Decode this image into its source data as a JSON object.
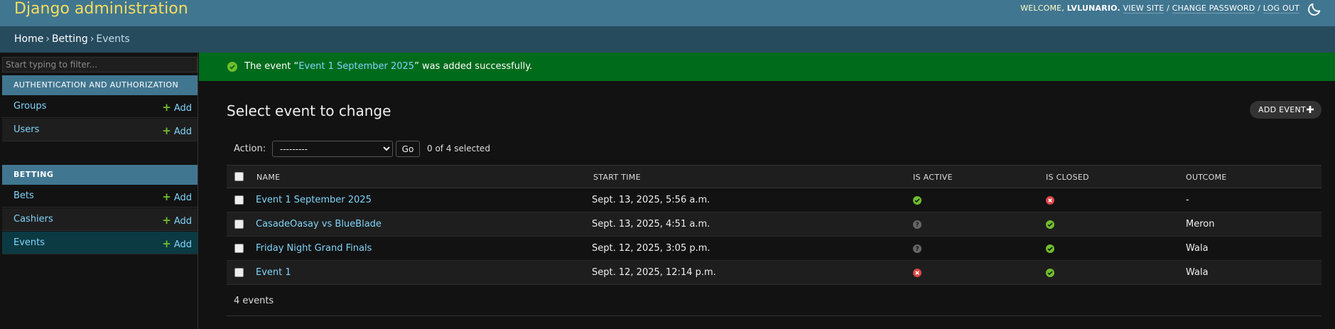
{
  "header": {
    "site_name": "Django administration",
    "welcome": "WELCOME,",
    "username": "LVLUNARIO.",
    "view_site": "VIEW SITE",
    "change_password": "CHANGE PASSWORD",
    "log_out": "LOG OUT",
    "separator": "/"
  },
  "breadcrumbs": {
    "home": "Home",
    "app": "Betting",
    "current": "Events",
    "separator": "›"
  },
  "sidebar": {
    "filter_placeholder": "Start typing to filter...",
    "modules": [
      {
        "caption": "AUTHENTICATION AND AUTHORIZATION",
        "models": [
          {
            "name": "Groups",
            "add": "Add"
          },
          {
            "name": "Users",
            "add": "Add"
          }
        ]
      },
      {
        "caption": "BETTING",
        "models": [
          {
            "name": "Bets",
            "add": "Add"
          },
          {
            "name": "Cashiers",
            "add": "Add"
          },
          {
            "name": "Events",
            "add": "Add"
          }
        ]
      }
    ]
  },
  "message": {
    "prefix": "The event “",
    "link": "Event 1 September 2025",
    "suffix": "” was added successfully."
  },
  "content": {
    "title": "Select event to change",
    "add_button": "ADD EVENT"
  },
  "actions": {
    "label": "Action:",
    "selected_option": "---------",
    "go": "Go",
    "selected_count": "0 of 4 selected"
  },
  "table": {
    "headers": [
      "NAME",
      "START TIME",
      "IS ACTIVE",
      "IS CLOSED",
      "OUTCOME"
    ],
    "rows": [
      {
        "name": "Event 1 September 2025",
        "start_time": "Sept. 13, 2025, 5:56 a.m.",
        "is_active": "yes",
        "is_closed": "no",
        "outcome": "-"
      },
      {
        "name": "CasadeOasay vs BlueBlade",
        "start_time": "Sept. 13, 2025, 4:51 a.m.",
        "is_active": "unknown",
        "is_closed": "yes",
        "outcome": "Meron"
      },
      {
        "name": "Friday Night Grand Finals",
        "start_time": "Sept. 12, 2025, 3:05 p.m.",
        "is_active": "unknown",
        "is_closed": "yes",
        "outcome": "Wala"
      },
      {
        "name": "Event 1",
        "start_time": "Sept. 12, 2025, 12:14 p.m.",
        "is_active": "no",
        "is_closed": "yes",
        "outcome": "Wala"
      }
    ]
  },
  "paginator": {
    "count": "4 events"
  },
  "colors": {
    "header_bg": "#417690",
    "breadcrumb_bg": "#264b5d",
    "branding": "#f5dd5d",
    "success_bg": "#006b1b",
    "link": "#81d4fa",
    "yes_icon": "#70bf2b",
    "no_icon": "#dd4646",
    "unknown_icon": "#666666"
  }
}
